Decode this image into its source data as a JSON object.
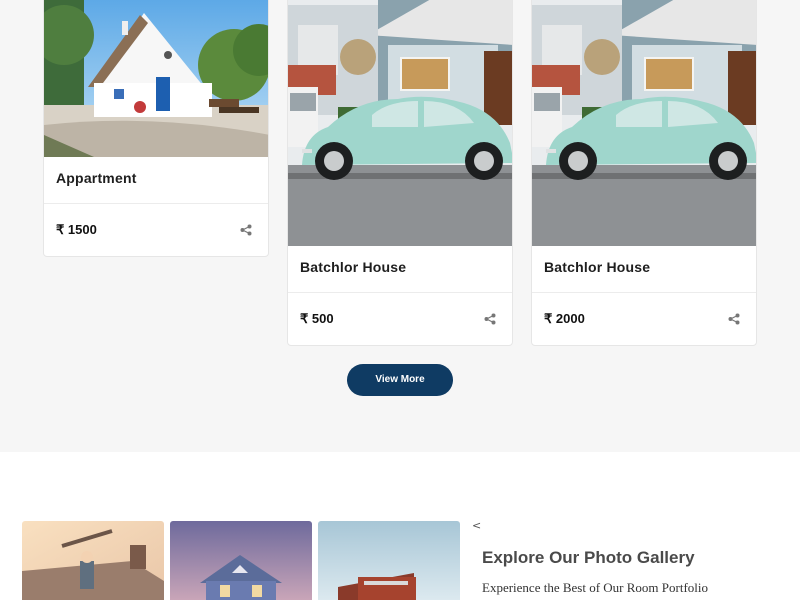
{
  "listings": [
    {
      "title": "Appartment",
      "price": "₹ 1500",
      "image": "white-cottage-photo"
    },
    {
      "title": "Batchlor House",
      "price": "₹ 500",
      "image": "vintage-car-house-photo"
    },
    {
      "title": "Batchlor House",
      "price": "₹ 2000",
      "image": "vintage-car-house-photo"
    }
  ],
  "view_more_label": "View More",
  "gallery": {
    "prev_arrow": "<",
    "heading": "Explore Our Photo Gallery",
    "subheading": "Experience the Best of Our Room Portfolio",
    "thumbnails": [
      "roof-worker-photo",
      "blue-house-photo",
      "red-house-photo"
    ]
  },
  "colors": {
    "section_bg": "#f6f6f6",
    "button_bg": "#0f3b63",
    "car_color": "#9fd6cc"
  },
  "icons": {
    "share": "share-icon"
  }
}
